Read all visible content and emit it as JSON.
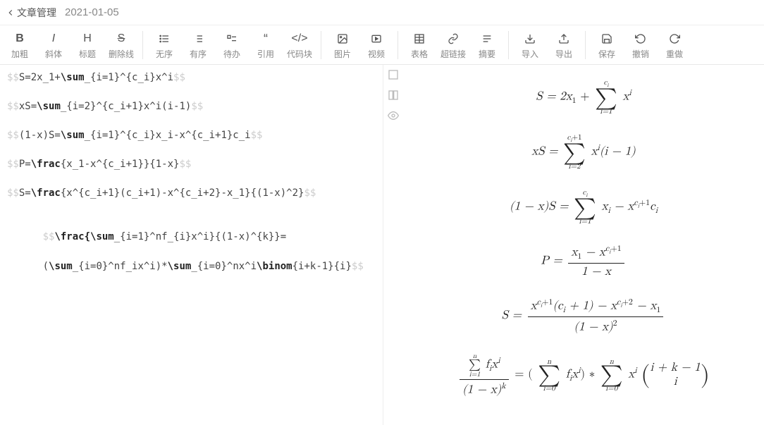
{
  "header": {
    "back_label": "文章管理",
    "title": "2021-01-05"
  },
  "toolbar": {
    "bold": "加粗",
    "italic": "斜体",
    "heading": "标题",
    "strike": "删除线",
    "ul": "无序",
    "ol": "有序",
    "todo": "待办",
    "quote": "引用",
    "code": "代码块",
    "image": "图片",
    "video": "视频",
    "table": "表格",
    "link": "超链接",
    "summary": "摘要",
    "import": "导入",
    "export": "导出",
    "save": "保存",
    "undo": "撤销",
    "redo": "重做"
  },
  "editor": {
    "lines": [
      {
        "pre": "$$",
        "body": "S=2x_1+",
        "kw": "\\sum",
        "post": "_{i=1}^{c_i}x^i",
        "end": "$$"
      },
      {
        "pre": "$$",
        "body": "xS=",
        "kw": "\\sum",
        "post": "_{i=2}^{c_i+1}x^i(i-1)",
        "end": "$$"
      },
      {
        "pre": "$$",
        "body": "(1-x)S=",
        "kw": "\\sum",
        "post": "_{i=1}^{c_i}x_i-x^{c_i+1}c_i",
        "end": "$$"
      },
      {
        "pre": "$$",
        "body": "P=",
        "kw": "\\frac",
        "post": "{x_1-x^{c_i+1}}{1-x}",
        "end": "$$"
      },
      {
        "pre": "$$",
        "body": "S=",
        "kw": "\\frac",
        "post": "{x^{c_i+1}(c_i+1)-x^{c_i+2}-x_1}{(1-x)^2}",
        "end": "$$"
      }
    ],
    "last1a": "$$",
    "last1kw": "\\frac{\\sum",
    "last1b": "_{i=1}^nf_{i}x^i}{(1-x)^{k}}=",
    "last2a": "(",
    "last2kw": "\\sum",
    "last2b": "_{i=0}^nf_ix^i)*",
    "last2kw2": "\\sum",
    "last2c": "_{i=0}^nx^i",
    "last2kw3": "\\binom",
    "last2d": "{i+k-1}{i}",
    "last2e": "$$"
  },
  "math": {
    "sigma": "∑",
    "eq1": {
      "l": "S = 2x",
      "sub1": "1",
      "mid": " + ",
      "top": "c",
      "topi": "i",
      "bot": "i=1",
      "r": "x",
      "sup": "i"
    },
    "eq2": {
      "l": "xS = ",
      "top": "c",
      "topi": "i",
      "topplus": "+1",
      "bot": "i=2",
      "mid": "x",
      "sup": "i",
      "r": "(i − 1)"
    },
    "eq3": {
      "l": "(1 − x)S = ",
      "top": "c",
      "topi": "i",
      "bot": "i=1",
      "mid": "x",
      "subi": "i",
      "minus": " − x",
      "exp": "c",
      "expi": "i",
      "expplus": "+1",
      "r": "c",
      "ri": "i"
    },
    "eq4": {
      "l": "P = ",
      "num_a": "x",
      "num_sub": "1",
      "num_minus": " − x",
      "num_exp": "c",
      "num_expi": "i",
      "num_plus": "+1",
      "den": "1 − x"
    },
    "eq5": {
      "l": "S = ",
      "n1": "x",
      "e1": "c",
      "e1i": "i",
      "e1p": "+1",
      "n2": "(c",
      "n2i": "i",
      "n3": " + 1) − x",
      "e2": "c",
      "e2i": "i",
      "e2p": "+2",
      "n4": " − x",
      "n4s": "1",
      "den": "(1 − x)",
      "denp": "2"
    },
    "eq6": {
      "sumtop": "n",
      "sumbot": "i=1",
      "f": "f",
      "fi": "i",
      "x": "x",
      "xi": "i",
      "den": "(1 − x)",
      "denk": "k",
      "eq": " = (",
      "rp": ") ∗ ",
      "bn1": "i + k − 1",
      "bn2": "i",
      "sumtop2": "n",
      "sumbot2": "i=0"
    }
  }
}
